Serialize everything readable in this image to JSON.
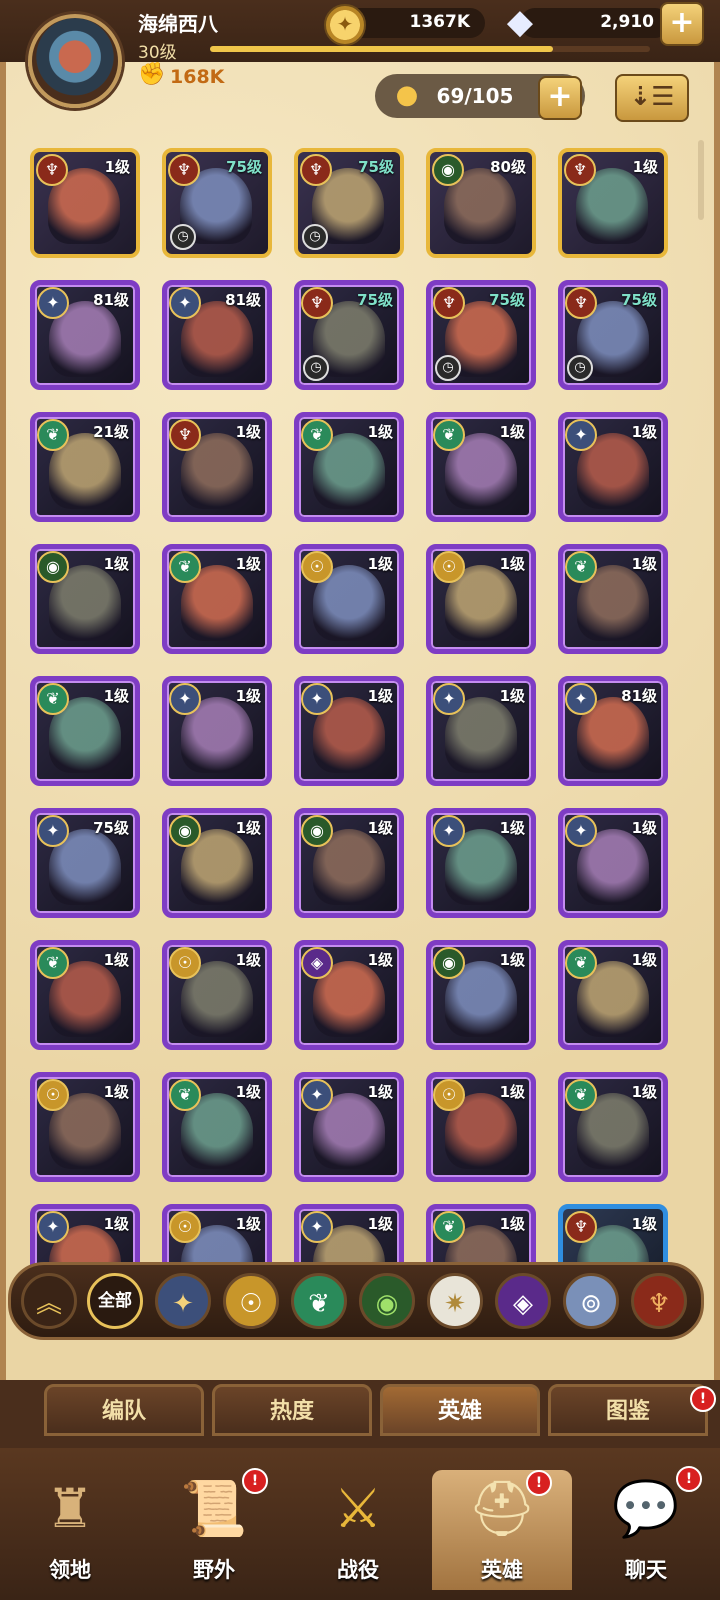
{
  "player": {
    "name": "海绵西八",
    "level": "30级",
    "power": "168K",
    "xp_progress": 0.78
  },
  "currency": {
    "gold": "1367K",
    "gems": "2,910"
  },
  "hero_count": "69/105",
  "heroes": [
    {
      "level": "1级",
      "faction": "maulers",
      "rarity": "legend",
      "teal": false,
      "timer": false
    },
    {
      "level": "75级",
      "faction": "maulers",
      "rarity": "legend",
      "teal": true,
      "timer": true
    },
    {
      "level": "75级",
      "faction": "maulers",
      "rarity": "legend",
      "teal": true,
      "timer": true
    },
    {
      "level": "80级",
      "faction": "graveborn",
      "rarity": "legend",
      "teal": false,
      "timer": false
    },
    {
      "level": "1级",
      "faction": "maulers",
      "rarity": "legend",
      "teal": false,
      "timer": false
    },
    {
      "level": "81级",
      "faction": "lightbearer",
      "rarity": "epic",
      "teal": false,
      "timer": false
    },
    {
      "level": "81级",
      "faction": "lightbearer",
      "rarity": "epic",
      "teal": false,
      "timer": false
    },
    {
      "level": "75级",
      "faction": "maulers",
      "rarity": "epic",
      "teal": true,
      "timer": true
    },
    {
      "level": "75级",
      "faction": "maulers",
      "rarity": "epic",
      "teal": true,
      "timer": true
    },
    {
      "level": "75级",
      "faction": "maulers",
      "rarity": "epic",
      "teal": true,
      "timer": true
    },
    {
      "level": "21级",
      "faction": "wilder",
      "rarity": "epic",
      "teal": false,
      "timer": false
    },
    {
      "level": "1级",
      "faction": "maulers",
      "rarity": "epic",
      "teal": false,
      "timer": false
    },
    {
      "level": "1级",
      "faction": "wilder",
      "rarity": "epic",
      "teal": false,
      "timer": false
    },
    {
      "level": "1级",
      "faction": "wilder",
      "rarity": "epic",
      "teal": false,
      "timer": false
    },
    {
      "level": "1级",
      "faction": "lightbearer",
      "rarity": "epic",
      "teal": false,
      "timer": false
    },
    {
      "level": "1级",
      "faction": "graveborn",
      "rarity": "epic",
      "teal": false,
      "timer": false
    },
    {
      "level": "1级",
      "faction": "wilder",
      "rarity": "epic",
      "teal": false,
      "timer": false
    },
    {
      "level": "1级",
      "faction": "dimensional",
      "rarity": "epic",
      "teal": false,
      "timer": false
    },
    {
      "level": "1级",
      "faction": "dimensional",
      "rarity": "epic",
      "teal": false,
      "timer": false
    },
    {
      "level": "1级",
      "faction": "wilder",
      "rarity": "epic",
      "teal": false,
      "timer": false
    },
    {
      "level": "1级",
      "faction": "wilder",
      "rarity": "epic",
      "teal": false,
      "timer": false
    },
    {
      "level": "1级",
      "faction": "lightbearer",
      "rarity": "epic",
      "teal": false,
      "timer": false
    },
    {
      "level": "1级",
      "faction": "lightbearer",
      "rarity": "epic",
      "teal": false,
      "timer": false
    },
    {
      "level": "1级",
      "faction": "lightbearer",
      "rarity": "epic",
      "teal": false,
      "timer": false
    },
    {
      "level": "81级",
      "faction": "lightbearer",
      "rarity": "epic",
      "teal": false,
      "timer": false
    },
    {
      "level": "75级",
      "faction": "lightbearer",
      "rarity": "epic",
      "teal": false,
      "timer": false
    },
    {
      "level": "1级",
      "faction": "graveborn",
      "rarity": "epic",
      "teal": false,
      "timer": false
    },
    {
      "level": "1级",
      "faction": "graveborn",
      "rarity": "epic",
      "teal": false,
      "timer": false
    },
    {
      "level": "1级",
      "faction": "lightbearer",
      "rarity": "epic",
      "teal": false,
      "timer": false
    },
    {
      "level": "1级",
      "faction": "lightbearer",
      "rarity": "epic",
      "teal": false,
      "timer": false
    },
    {
      "level": "1级",
      "faction": "wilder",
      "rarity": "epic",
      "teal": false,
      "timer": false
    },
    {
      "level": "1级",
      "faction": "dimensional",
      "rarity": "epic",
      "teal": false,
      "timer": false
    },
    {
      "level": "1级",
      "faction": "hypogean",
      "rarity": "epic",
      "teal": false,
      "timer": false
    },
    {
      "level": "1级",
      "faction": "graveborn",
      "rarity": "epic",
      "teal": false,
      "timer": false
    },
    {
      "level": "1级",
      "faction": "wilder",
      "rarity": "epic",
      "teal": false,
      "timer": false
    },
    {
      "level": "1级",
      "faction": "dimensional",
      "rarity": "epic",
      "teal": false,
      "timer": false
    },
    {
      "level": "1级",
      "faction": "wilder",
      "rarity": "epic",
      "teal": false,
      "timer": false
    },
    {
      "level": "1级",
      "faction": "lightbearer",
      "rarity": "epic",
      "teal": false,
      "timer": false
    },
    {
      "level": "1级",
      "faction": "dimensional",
      "rarity": "epic",
      "teal": false,
      "timer": false
    },
    {
      "level": "1级",
      "faction": "wilder",
      "rarity": "epic",
      "teal": false,
      "timer": false
    },
    {
      "level": "1级",
      "faction": "lightbearer",
      "rarity": "epic",
      "teal": false,
      "timer": false
    },
    {
      "level": "1级",
      "faction": "dimensional",
      "rarity": "epic",
      "teal": false,
      "timer": false
    },
    {
      "level": "1级",
      "faction": "lightbearer",
      "rarity": "epic",
      "teal": false,
      "timer": false
    },
    {
      "level": "1级",
      "faction": "wilder",
      "rarity": "epic",
      "teal": false,
      "timer": false
    },
    {
      "level": "1级",
      "faction": "maulers",
      "rarity": "mythic",
      "teal": false,
      "timer": false
    }
  ],
  "filters": {
    "all_label": "全部"
  },
  "subtabs": [
    {
      "label": "编队",
      "active": false,
      "badge": false
    },
    {
      "label": "热度",
      "active": false,
      "badge": false
    },
    {
      "label": "英雄",
      "active": true,
      "badge": false
    },
    {
      "label": "图鉴",
      "active": false,
      "badge": true
    }
  ],
  "nav": [
    {
      "label": "领地",
      "icon": "castle-icon",
      "active": false,
      "badge": false
    },
    {
      "label": "野外",
      "icon": "scroll-map-icon",
      "active": false,
      "badge": true
    },
    {
      "label": "战役",
      "icon": "sword-shield-icon",
      "active": false,
      "badge": false
    },
    {
      "label": "英雄",
      "icon": "helmet-icon",
      "active": true,
      "badge": true
    },
    {
      "label": "聊天",
      "icon": "chat-bubble-icon",
      "active": false,
      "badge": true
    }
  ],
  "badge_text": "!",
  "colors": {
    "accent_gold": "#f0c64a",
    "epic_purple": "#7e3cc4",
    "legend_gold": "#e8b73a",
    "mythic_blue": "#2f8ee0",
    "badge_red": "#d82020"
  }
}
